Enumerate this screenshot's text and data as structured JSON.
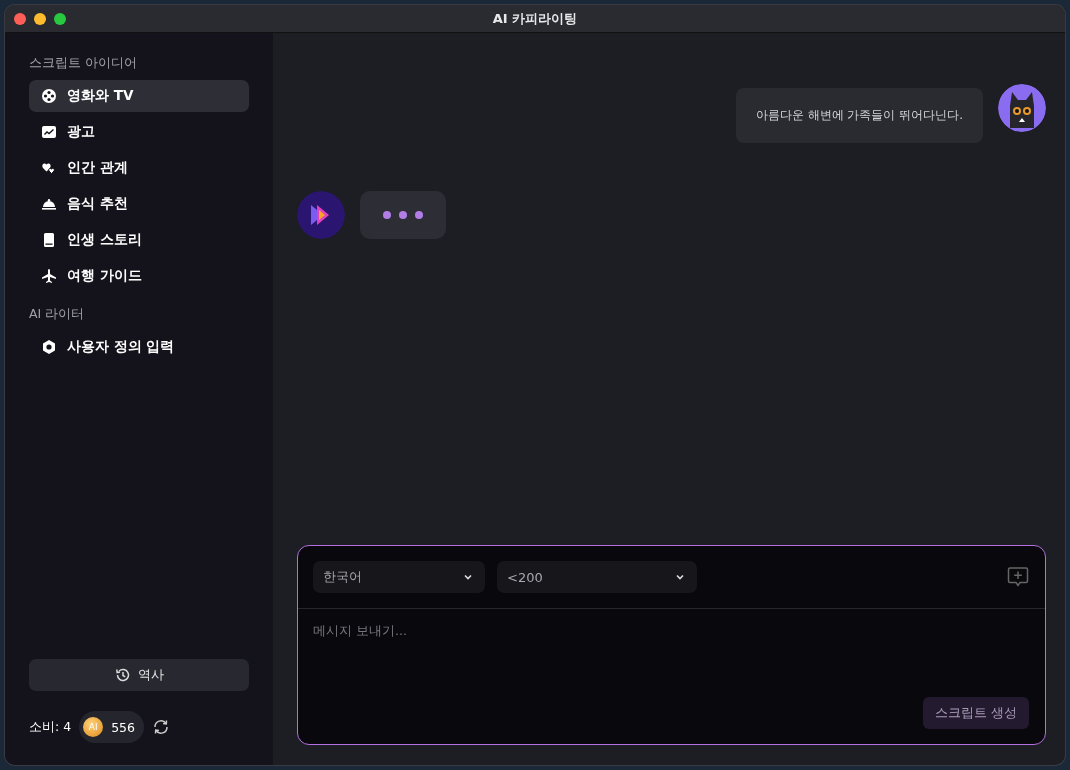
{
  "window": {
    "title": "AI 카피라이팅"
  },
  "sidebar": {
    "sections": [
      {
        "title": "스크립트 아이디어",
        "items": [
          {
            "label": "영화와 TV",
            "kind": "film",
            "selected": true
          },
          {
            "label": "광고",
            "kind": "chart",
            "selected": false
          },
          {
            "label": "인간 관계",
            "kind": "hearts",
            "selected": false
          },
          {
            "label": "음식 추천",
            "kind": "cloche",
            "selected": false
          },
          {
            "label": "인생 스토리",
            "kind": "book",
            "selected": false
          },
          {
            "label": "여행 가이드",
            "kind": "plane",
            "selected": false
          }
        ]
      },
      {
        "title": "AI 라이터",
        "items": [
          {
            "label": "사용자 정의 입력",
            "kind": "hexagon",
            "selected": false
          }
        ]
      }
    ],
    "history_button": "역사",
    "usage": {
      "label": "소비: 4",
      "coin_label": "AI",
      "balance": "556"
    }
  },
  "chat": {
    "messages": [
      {
        "kind": "user",
        "text": "아름다운 해변에 가족들이 뛰어다닌다."
      },
      {
        "kind": "typing"
      }
    ]
  },
  "composer": {
    "language": "한국어",
    "length": "<200",
    "placeholder": "메시지 보내기...",
    "submit": "스크립트 생성"
  }
}
